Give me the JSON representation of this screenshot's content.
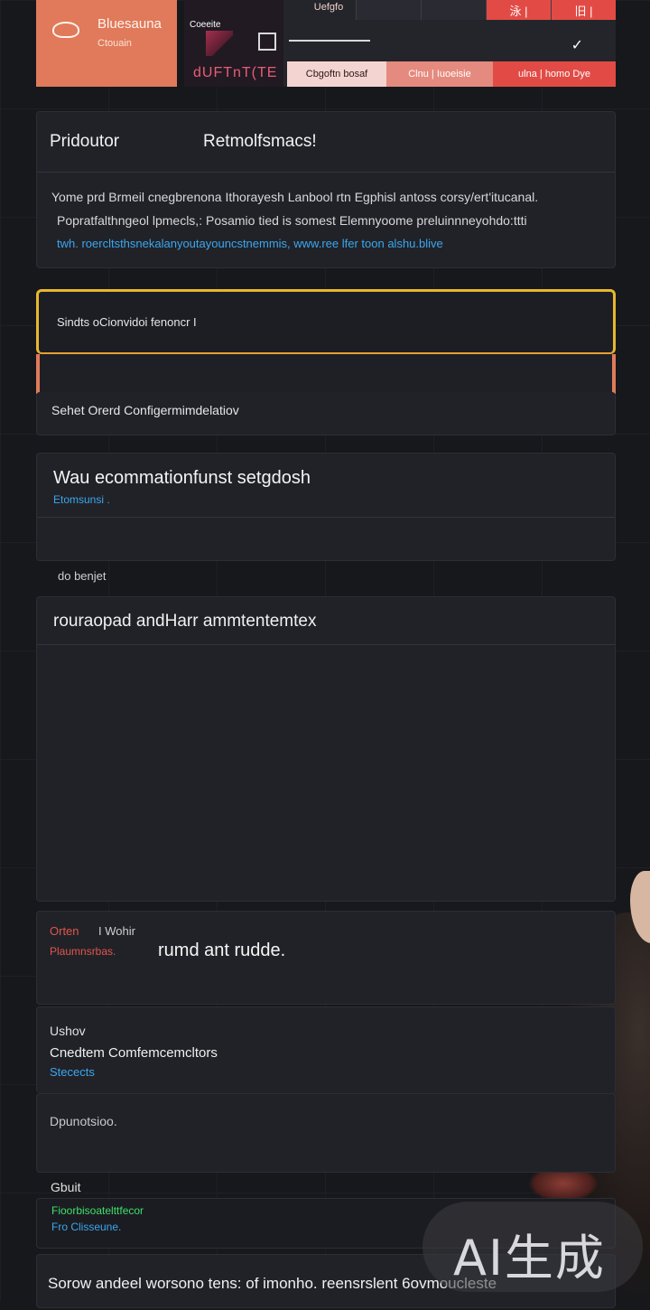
{
  "header": {
    "brand_title": "Bluesauna",
    "brand_subtitle": "Ctouain",
    "media_label": "Coeeite",
    "media_caption": "dUFTnT(TE",
    "top_label": "Uefgfo",
    "top_tab_1": "泳 |",
    "top_tab_2": "旧 |",
    "check_symbol": "✓",
    "subtabs": [
      "Cbgoftn bosaf",
      "Clnu | Iuoeisie",
      "ulna | homo Dye"
    ]
  },
  "panel_overview": {
    "title_left": "Pridoutor",
    "title_right": "Retmolfsmacs!",
    "line1": "Yome prd Brmeil cnegbrenona Ithorayesh Lanbool rtn Egphisl antoss corsy/ert'itucanal.",
    "line2": "Popratfalthngeol lpmecls,: Posamio tied is somest Elemnyoome preluinnneyohdo:ttti",
    "link": "twh. roercltsthsnekalanyoutayouncstnemmis, www.ree lfer toon alshu.blive"
  },
  "panel_search": {
    "text": "Sindts oCionvidoi fenoncr I"
  },
  "panel_select": {
    "text": "Sehet Orerd Configermimdelatiov"
  },
  "panel_config": {
    "title": "Wau ecommationfunst setgdosh",
    "subtitle": "Etomsunsi ."
  },
  "section_label": "do benjet",
  "panel_editor": {
    "title": "rouraopad andHarr ammtentemtex"
  },
  "panel_option": {
    "label_red": "Orten",
    "label_white": "I Wohir",
    "sub_red": "Plaumnsrbas.",
    "big_text": "rumd ant rudde."
  },
  "panel_details": {
    "line_a": "Ushov",
    "line_b": "Cnedtem Comfemcemcltors",
    "line_c": "Stecects"
  },
  "panel_desc": {
    "text": "Dpunotsioo."
  },
  "section_label_2": "Gbuit",
  "panel_status": {
    "green": "Fioorbisoatelttfecor",
    "blue": "Fro Clisseune."
  },
  "panel_footer": {
    "text": "Sorow andeel worsono tens: of imonho. reensrslent 6ovmoucleste"
  },
  "watermark": "AI生成"
}
